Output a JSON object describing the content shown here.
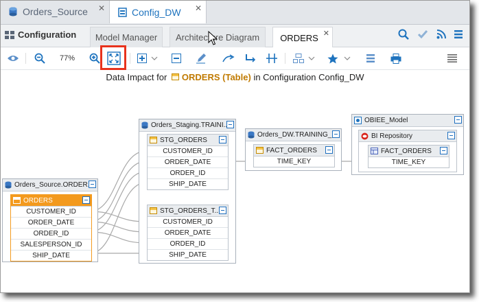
{
  "doc_tabs": [
    {
      "label": "Orders_Source",
      "active": false
    },
    {
      "label": "Config_DW",
      "active": true
    }
  ],
  "close_glyph": "✕",
  "config_label": "Configuration",
  "sub_tabs": [
    {
      "label": "Model Manager"
    },
    {
      "label": "Architecture Diagram"
    },
    {
      "label": "ORDERS",
      "active": true
    }
  ],
  "toolbar": {
    "zoom": "77%"
  },
  "canvas": {
    "title_prefix": "Data Impact for",
    "title_table": "ORDERS (Table)",
    "title_suffix": "in Configuration Config_DW"
  },
  "nodes": {
    "source": {
      "title": "Orders_Source.ORDER...",
      "table": "ORDERS",
      "columns": [
        "CUSTOMER_ID",
        "ORDER_DATE",
        "ORDER_ID",
        "SALESPERSON_ID",
        "SHIP_DATE"
      ]
    },
    "staging": {
      "title": "Orders_Staging.TRAINI...",
      "table1": "STG_ORDERS",
      "table1_columns": [
        "CUSTOMER_ID",
        "ORDER_DATE",
        "ORDER_ID",
        "SHIP_DATE"
      ],
      "table2": "STG_ORDERS_T...",
      "table2_columns": [
        "CUSTOMER_ID",
        "ORDER_DATE",
        "ORDER_ID",
        "SHIP_DATE"
      ]
    },
    "dw": {
      "title": "Orders_DW.TRAINING_...",
      "table": "FACT_ORDERS",
      "columns": [
        "TIME_KEY"
      ]
    },
    "obiee": {
      "title": "OBIEE_Model",
      "repo": "BI Repository",
      "table": "FACT_ORDERS",
      "columns": [
        "TIME_KEY"
      ]
    }
  },
  "colors": {
    "accent": "#1e73be",
    "table_orange": "#f39a1e",
    "highlight": "#e8321c"
  }
}
